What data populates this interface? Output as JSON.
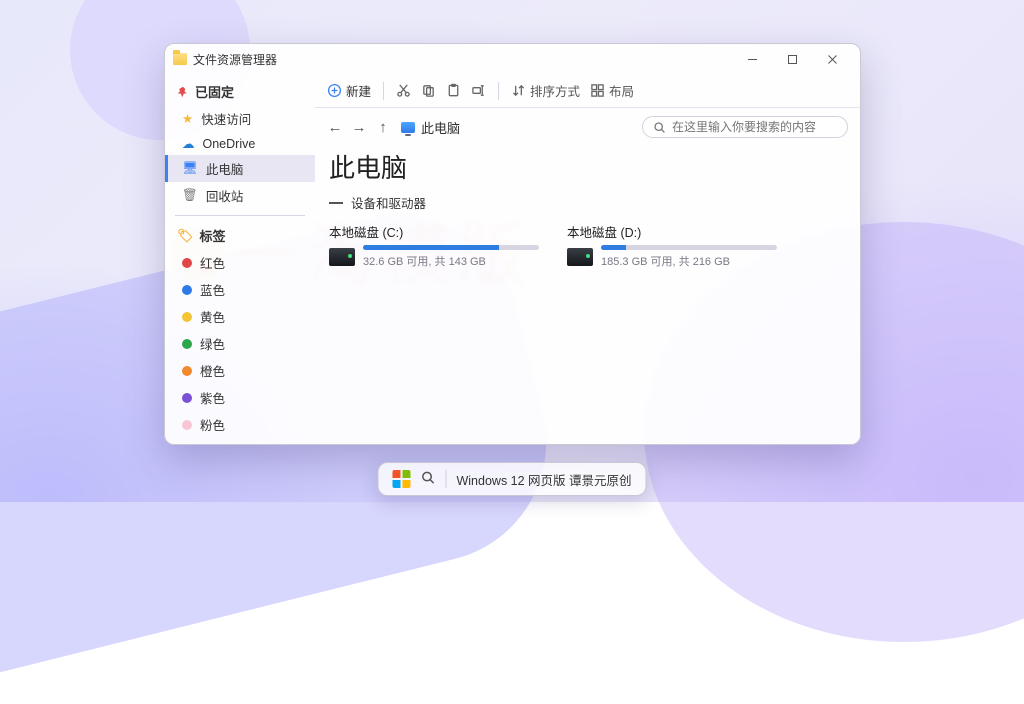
{
  "window": {
    "title": "文件资源管理器"
  },
  "sidebar": {
    "pinned_title": "已固定",
    "items": [
      {
        "label": "快速访问"
      },
      {
        "label": "OneDrive"
      },
      {
        "label": "此电脑"
      },
      {
        "label": "回收站"
      }
    ],
    "tags_title": "标签",
    "tags": [
      {
        "label": "红色",
        "color": "#e04646"
      },
      {
        "label": "蓝色",
        "color": "#2e7ae6"
      },
      {
        "label": "黄色",
        "color": "#f3c534"
      },
      {
        "label": "绿色",
        "color": "#2fa64b"
      },
      {
        "label": "橙色",
        "color": "#f08a2c"
      },
      {
        "label": "紫色",
        "color": "#7b4fd6"
      },
      {
        "label": "粉色",
        "color": "#f7c7d6"
      }
    ]
  },
  "toolbar": {
    "new": "新建",
    "sort": "排序方式",
    "layout": "布局"
  },
  "breadcrumb": {
    "label": "此电脑"
  },
  "search": {
    "placeholder": "在这里输入你要搜索的内容"
  },
  "page": {
    "title": "此电脑",
    "section_devices": "设备和驱动器"
  },
  "drives": [
    {
      "label": "本地磁盘 (C:)",
      "free": "32.6 GB",
      "total": "143 GB",
      "fill_pct": 77,
      "subtext": "32.6 GB 可用, 共 143 GB"
    },
    {
      "label": "本地磁盘 (D:)",
      "free": "185.3 GB",
      "total": "216 GB",
      "fill_pct": 14,
      "subtext": "185.3 GB 可用, 共 216 GB"
    }
  ],
  "taskbar": {
    "caption": "Windows 12 网页版 谭景元原创"
  },
  "watermark": "一淘模版"
}
